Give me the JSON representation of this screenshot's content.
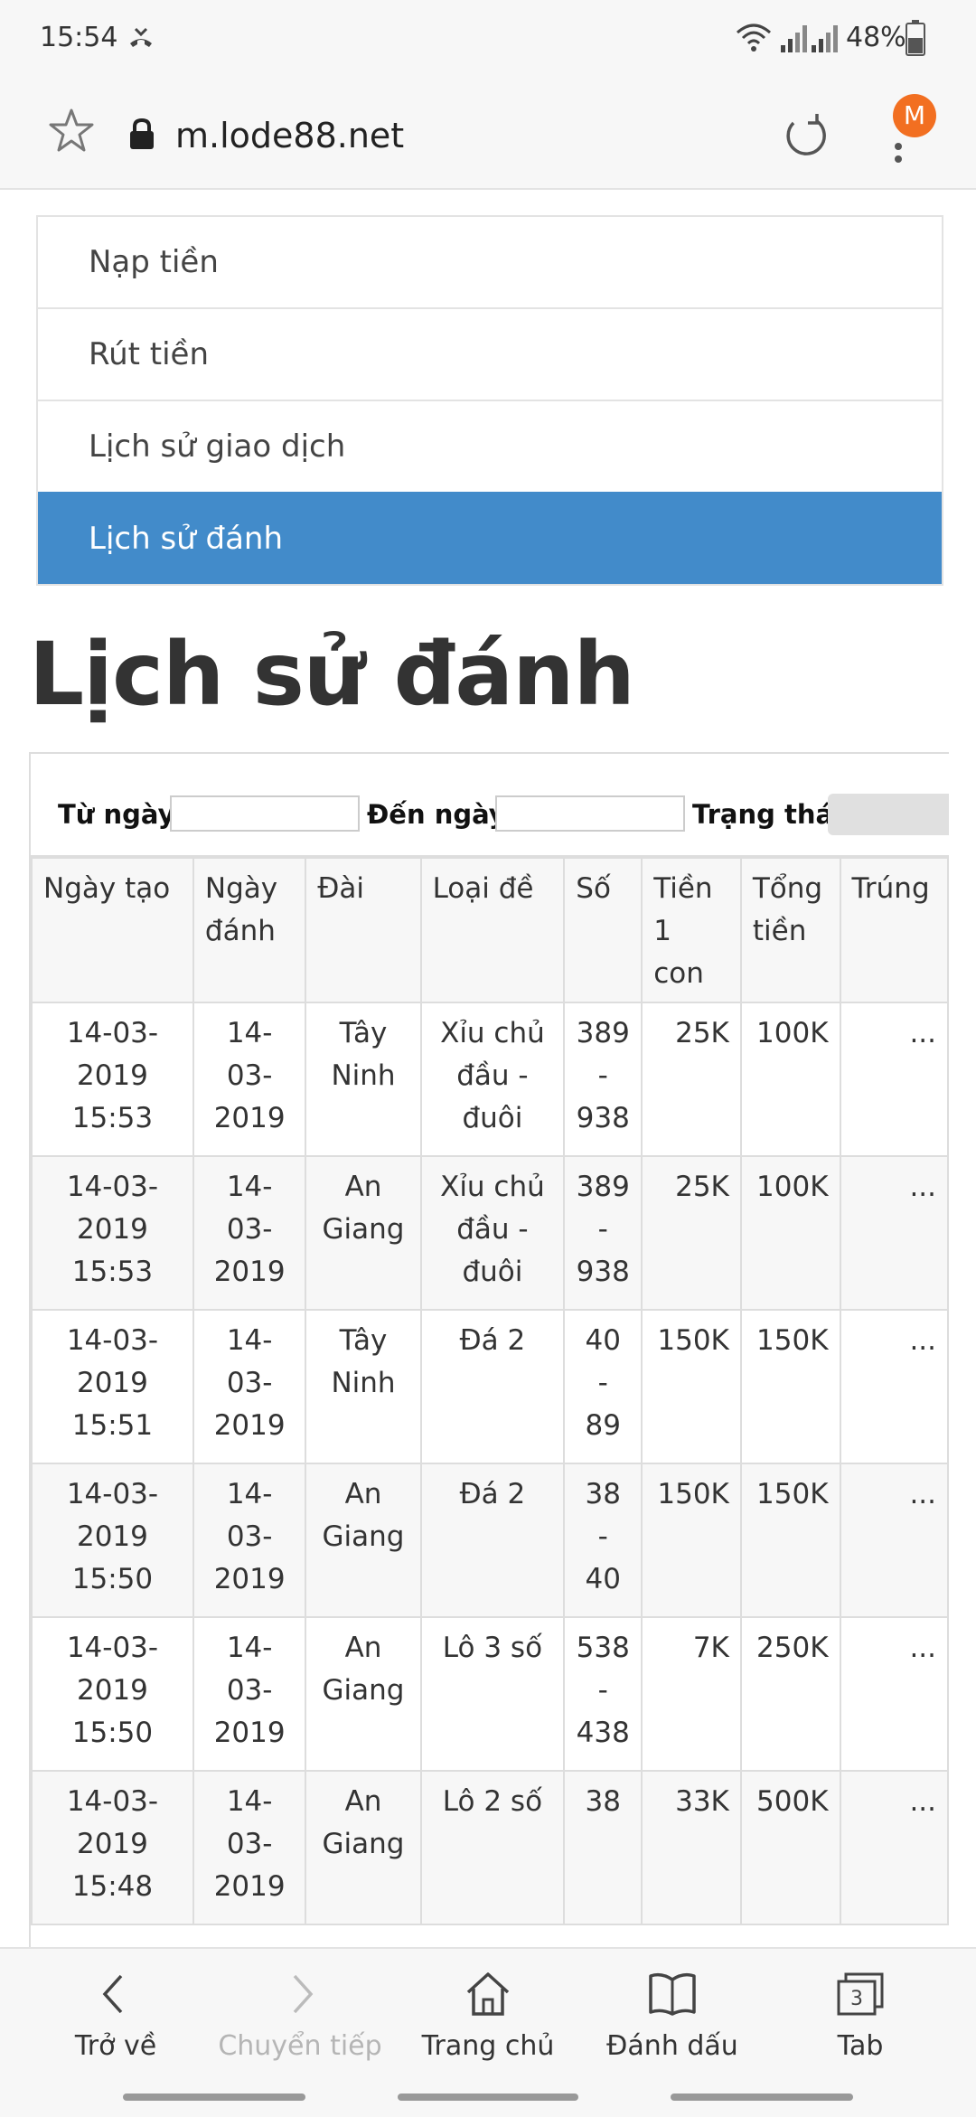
{
  "status_bar": {
    "time": "15:54",
    "battery": "48%"
  },
  "browser": {
    "url": "m.lode88.net",
    "avatar_letter": "M",
    "avatar_color": "#f26f21"
  },
  "menu": {
    "items": [
      {
        "label": "Nạp tiền",
        "active": false
      },
      {
        "label": "Rút tiền",
        "active": false
      },
      {
        "label": "Lịch sử giao dịch",
        "active": false
      },
      {
        "label": "Lịch sử đánh",
        "active": true
      }
    ],
    "active_color": "#428bca"
  },
  "page": {
    "title": "Lịch sử đánh"
  },
  "filters": {
    "from_label": "Từ ngày",
    "to_label": "Đến ngày",
    "status_label": "Trạng thái"
  },
  "table": {
    "headers": [
      "Ngày tạo",
      "Ngày đánh",
      "Đài",
      "Loại đề",
      "Số",
      "Tiền 1 con",
      "Tổng tiền",
      "Trúng"
    ],
    "rows": [
      [
        "14-03-2019 15:53",
        "14-03-2019",
        "Tây Ninh",
        "Xỉu chủ đầu - đuôi",
        "389 - 938",
        "25K",
        "100K",
        "..."
      ],
      [
        "14-03-2019 15:53",
        "14-03-2019",
        "An Giang",
        "Xỉu chủ đầu - đuôi",
        "389 - 938",
        "25K",
        "100K",
        "..."
      ],
      [
        "14-03-2019 15:51",
        "14-03-2019",
        "Tây Ninh",
        "Đá 2",
        "40 - 89",
        "150K",
        "150K",
        "..."
      ],
      [
        "14-03-2019 15:50",
        "14-03-2019",
        "An Giang",
        "Đá 2",
        "38 - 40",
        "150K",
        "150K",
        "..."
      ],
      [
        "14-03-2019 15:50",
        "14-03-2019",
        "An Giang",
        "Lô 3 số",
        "538 - 438",
        "7K",
        "250K",
        "..."
      ],
      [
        "14-03-2019 15:48",
        "14-03-2019",
        "An Giang",
        "Lô 2 số",
        "38",
        "33K",
        "500K",
        "..."
      ]
    ]
  },
  "bottom_nav": {
    "items": [
      {
        "label": "Trở về",
        "icon": "back-arrow-icon",
        "enabled": true
      },
      {
        "label": "Chuyển tiếp",
        "icon": "forward-arrow-icon",
        "enabled": false
      },
      {
        "label": "Trang chủ",
        "icon": "home-icon",
        "enabled": true
      },
      {
        "label": "Đánh dấu",
        "icon": "bookmark-book-icon",
        "enabled": true
      },
      {
        "label": "Tab",
        "icon": "tabs-icon",
        "enabled": true,
        "count": "3"
      }
    ]
  }
}
